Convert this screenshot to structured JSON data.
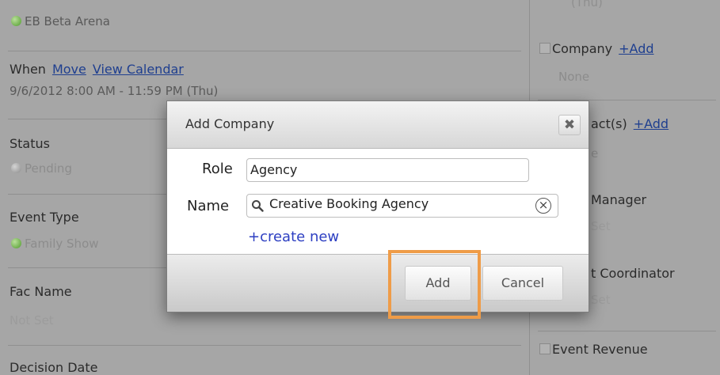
{
  "background": {
    "location": "EB Beta Arena",
    "when": {
      "label": "When",
      "move_link": "Move",
      "calendar_link": "View Calendar",
      "datetime": "9/6/2012 8:00 AM - 11:59 PM (Thu)"
    },
    "status": {
      "label": "Status",
      "value": "Pending"
    },
    "event_type": {
      "label": "Event Type",
      "value": "Family Show"
    },
    "fac_name": {
      "label": "Fac Name",
      "value": "Not Set"
    },
    "decision_date": {
      "label": "Decision Date"
    },
    "right": {
      "top_partial": "(Thu)",
      "company": {
        "label": "Company",
        "add_link": "+Add",
        "value": "None"
      },
      "contacts": {
        "label": "act(s)",
        "add_link": "+Add",
        "value": "e"
      },
      "manager": {
        "label": "Manager",
        "value": "Set"
      },
      "coordinator": {
        "label": "t Coordinator",
        "value": "Set"
      },
      "revenue": {
        "label": "Event Revenue"
      }
    }
  },
  "modal": {
    "title": "Add Company",
    "role_label": "Role",
    "role_value": "Agency",
    "name_label": "Name",
    "name_value": "Creative Booking Agency",
    "create_new": "+create new",
    "add_button": "Add",
    "cancel_button": "Cancel",
    "highlight_color": "#ef9c48"
  },
  "icons": {
    "close": "close-icon",
    "search": "search-icon",
    "clear": "clear-icon"
  }
}
